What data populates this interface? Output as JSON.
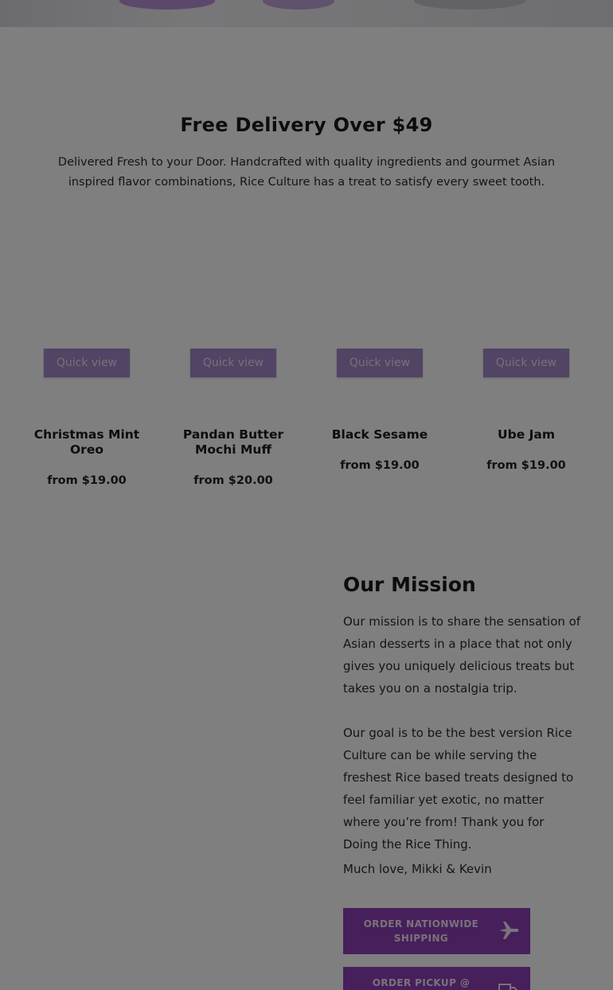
{
  "delivery": {
    "title": "Free Delivery Over $49",
    "description": "Delivered Fresh to your Door. Handcrafted with quality ingredients and gourmet Asian inspired flavor combinations, Rice Culture has a treat to satisfy every sweet tooth."
  },
  "products": [
    {
      "name": "Christmas Mint Oreo",
      "price": "from $19.00",
      "quick_view": "Quick view"
    },
    {
      "name": "Pandan Butter Mochi Muff",
      "price": "from $20.00",
      "quick_view": "Quick view"
    },
    {
      "name": "Black Sesame",
      "price": "from $19.00",
      "quick_view": "Quick view"
    },
    {
      "name": "Ube Jam",
      "price": "from $19.00",
      "quick_view": "Quick view"
    }
  ],
  "mission": {
    "title": "Our Mission",
    "paragraph1": "Our mission is to share the sensation of Asian desserts in a place that not only gives you uniquely delicious treats but takes you on a nostalgia trip.",
    "paragraph2": "Our goal is to be the best version Rice Culture can be while serving the freshest Rice based treats designed to feel familiar yet exotic, no matter where you’re from! Thank you for Doing the Rice Thing.",
    "signature": "Much love, Mikki & Kevin"
  },
  "buttons": {
    "nationwide": {
      "label": "ORDER NATIONWIDE SHIPPING",
      "icon": "airplane-icon"
    },
    "pickup": {
      "label": "ORDER PICKUP @",
      "icon": "truck-icon"
    }
  },
  "colors": {
    "accent": "#8e3fb7",
    "quick_view_bg": "#a589c9",
    "overlay": "rgba(0,0,0,0.5)"
  }
}
